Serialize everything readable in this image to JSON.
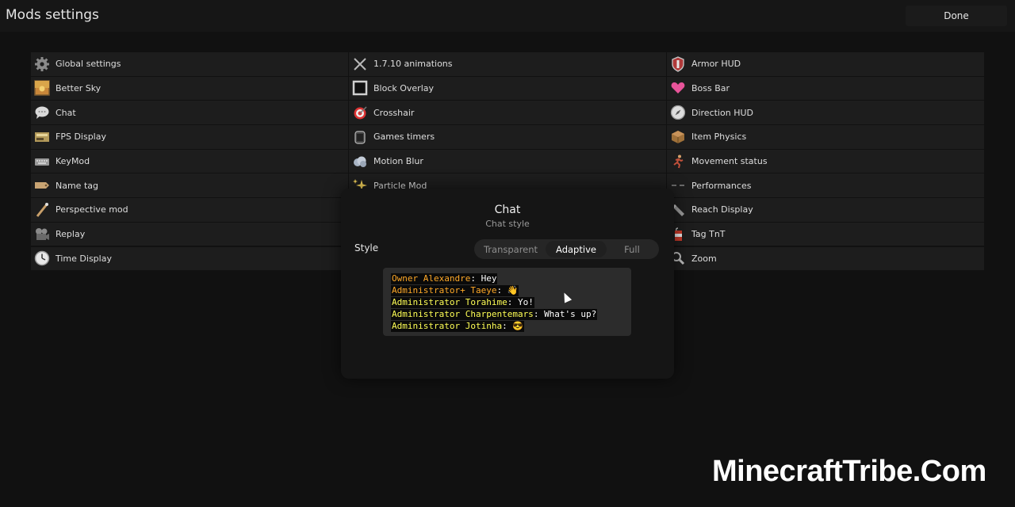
{
  "header": {
    "title": "Mods settings",
    "done_label": "Done"
  },
  "columns": [
    [
      {
        "label": "Global settings",
        "icon": "gear-icon"
      },
      {
        "label": "Better Sky",
        "icon": "sky-icon"
      },
      {
        "label": "Chat",
        "icon": "chat-bubble-icon"
      },
      {
        "label": "FPS Display",
        "icon": "fps-icon"
      },
      {
        "label": "KeyMod",
        "icon": "keyboard-icon"
      },
      {
        "label": "Name tag",
        "icon": "name-tag-icon"
      },
      {
        "label": "Perspective mod",
        "icon": "perspective-icon"
      },
      {
        "label": "Replay",
        "icon": "camera-icon"
      },
      {
        "label": "Time Display",
        "icon": "clock-icon"
      }
    ],
    [
      {
        "label": "1.7.10 animations",
        "icon": "crossed-swords-icon"
      },
      {
        "label": "Block Overlay",
        "icon": "block-outline-icon"
      },
      {
        "label": "Crosshair",
        "icon": "target-icon"
      },
      {
        "label": "Games timers",
        "icon": "stopwatch-icon"
      },
      {
        "label": "Motion Blur",
        "icon": "blur-cloud-icon"
      },
      {
        "label": "Particle Mod",
        "icon": "sparkles-icon"
      }
    ],
    [
      {
        "label": "Armor HUD",
        "icon": "shield-icon"
      },
      {
        "label": "Boss Bar",
        "icon": "heart-icon"
      },
      {
        "label": "Direction HUD",
        "icon": "compass-icon"
      },
      {
        "label": "Item Physics",
        "icon": "crate-icon"
      },
      {
        "label": "Movement status",
        "icon": "running-man-icon"
      },
      {
        "label": "Performances",
        "icon": "speedometer-icon"
      },
      {
        "label": "Reach Display",
        "icon": "ruler-icon"
      },
      {
        "label": "Tag TnT",
        "icon": "tnt-icon"
      },
      {
        "label": "Zoom",
        "icon": "magnifier-icon"
      }
    ]
  ],
  "panel": {
    "title": "Chat",
    "subtitle": "Chat style",
    "style_label": "Style",
    "options": [
      "Transparent",
      "Adaptive",
      "Full"
    ],
    "selected": "Adaptive"
  },
  "chat_preview": [
    {
      "name": "Owner Alexandre",
      "msg": "Hey",
      "name_color": "#ffa928"
    },
    {
      "name": "Administrator+ Taeye",
      "msg": "👋",
      "name_color": "#ffa928"
    },
    {
      "name": "Administrator Torahime",
      "msg": "Yo!",
      "name_color": "#ffff55"
    },
    {
      "name": "Administrator Charpentemars",
      "msg": "What's up?",
      "name_color": "#ffff55"
    },
    {
      "name": "Administrator Jotinha",
      "msg": "😎",
      "name_color": "#ffff55"
    }
  ],
  "watermark": "MinecraftTribe.Com"
}
